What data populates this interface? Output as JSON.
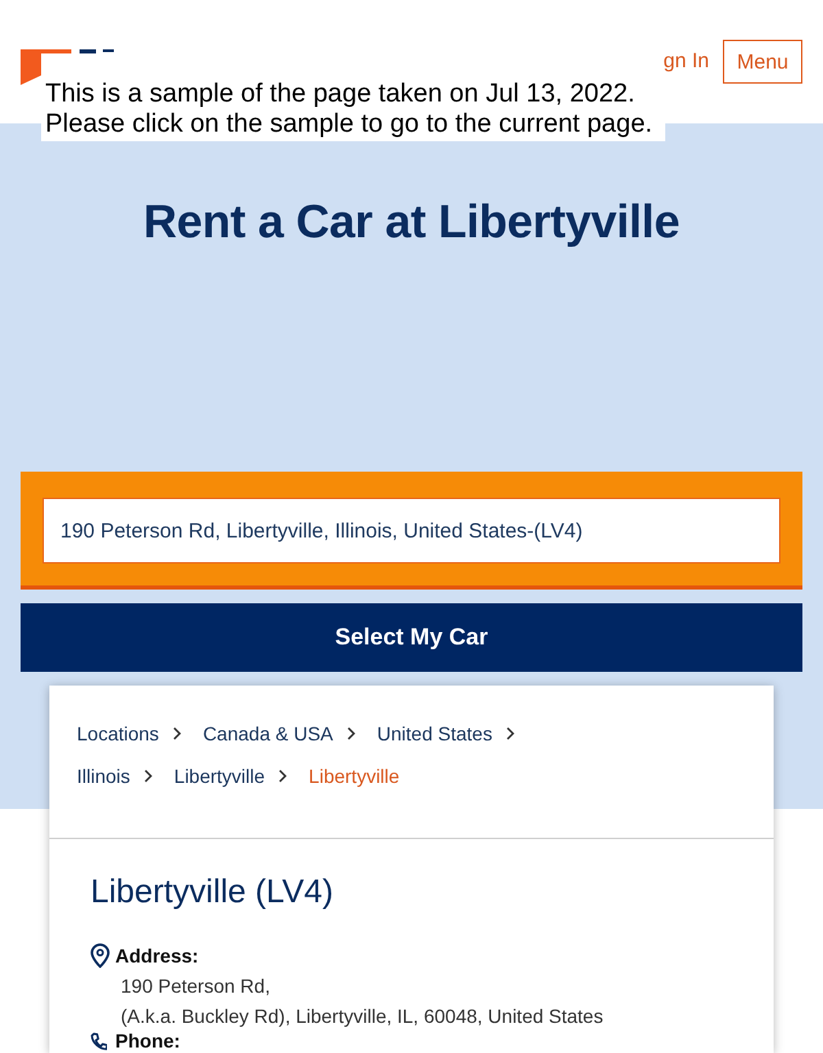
{
  "header": {
    "sign_in": "gn In",
    "menu_button": "Menu"
  },
  "archive_notice": {
    "lines": [
      "This is a sample of the page taken on Jul 13, 2022.",
      "Please click on the sample to go to the current page."
    ]
  },
  "hero": {
    "title": "Rent a Car at Libertyville"
  },
  "search": {
    "value": "190 Peterson Rd, Libertyville, Illinois, United States-(LV4)",
    "submit_button": "Select My Car"
  },
  "breadcrumbs": [
    {
      "label": "Locations",
      "current": false
    },
    {
      "label": "Canada & USA",
      "current": false
    },
    {
      "label": "United States",
      "current": false
    },
    {
      "label": "Illinois",
      "current": false
    },
    {
      "label": "Libertyville",
      "current": false
    },
    {
      "label": "Libertyville",
      "current": true
    }
  ],
  "location": {
    "title": "Libertyville (LV4)",
    "details": [
      {
        "kind": "address",
        "label": "Address:",
        "lines": [
          "190 Peterson Rd,",
          "(A.k.a. Buckley Rd), Libertyville, IL, 60048, United States"
        ]
      },
      {
        "kind": "phone",
        "label": "Phone:"
      }
    ]
  }
}
